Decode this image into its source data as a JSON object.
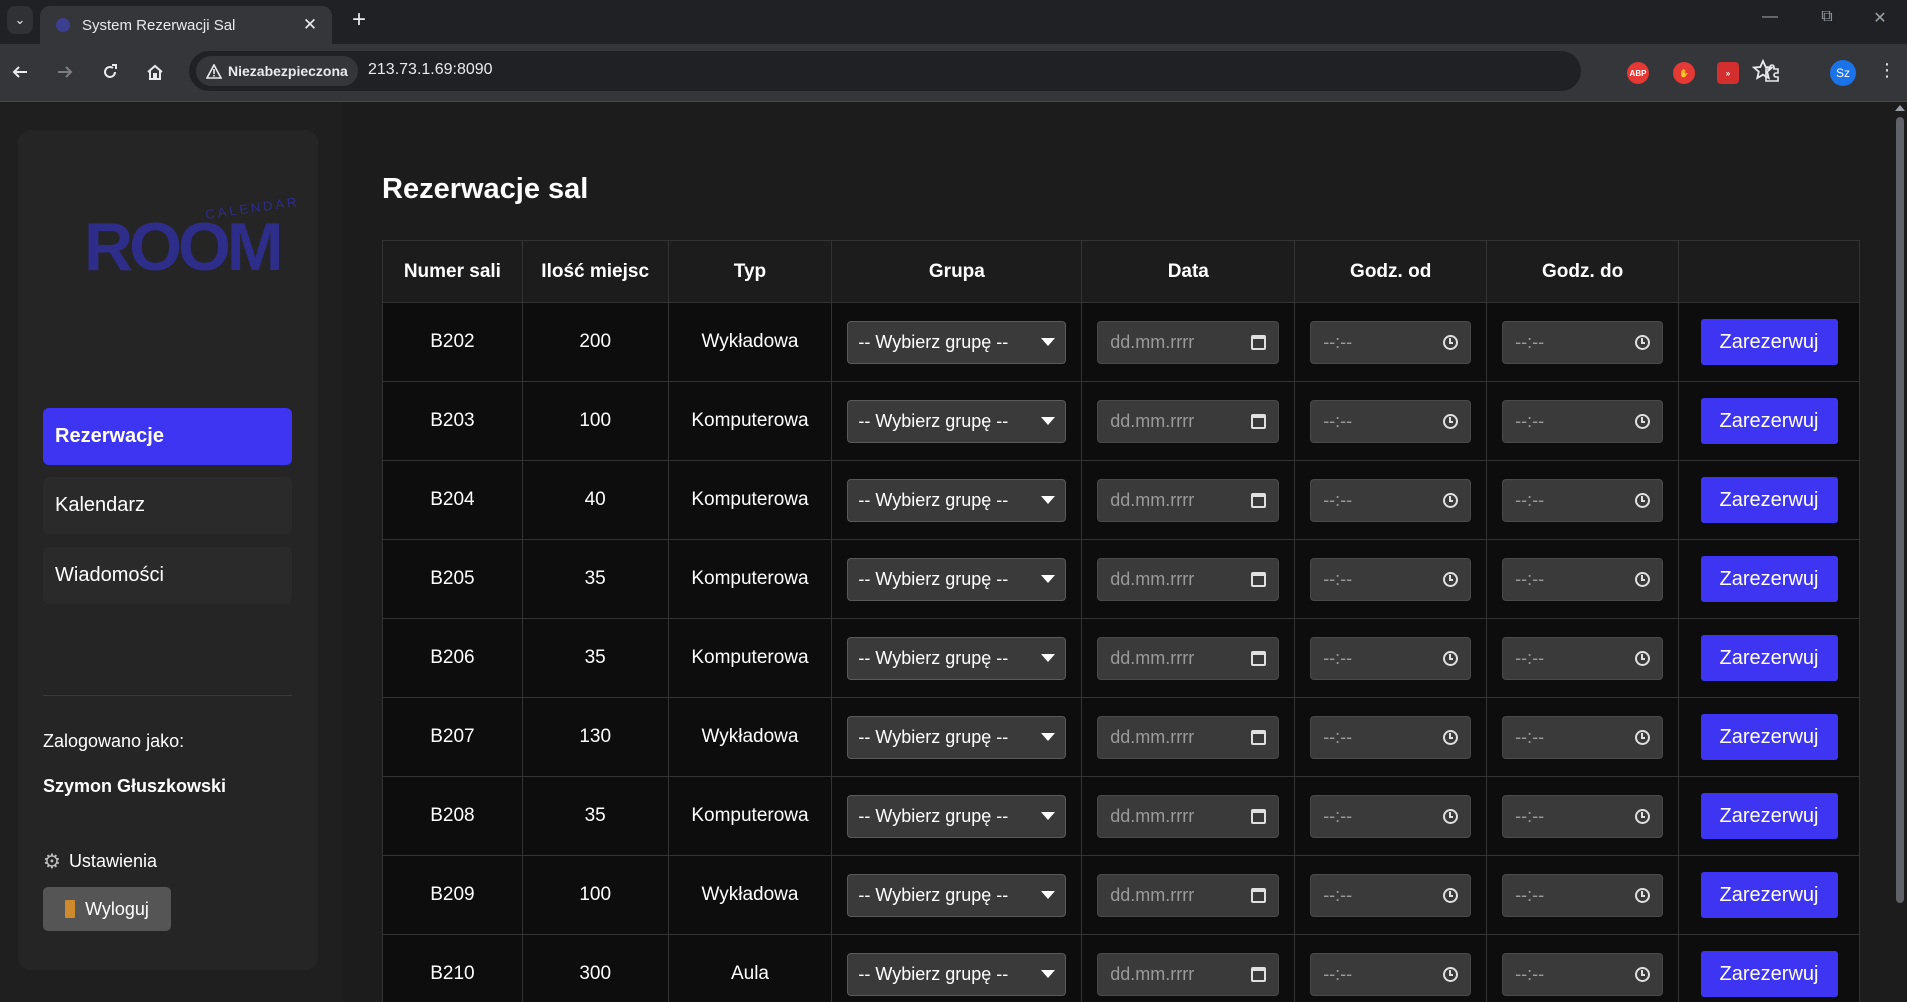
{
  "browser": {
    "tab_title": "System Rezerwacji Sal",
    "security_label": "Niezabezpieczona",
    "url": "213.73.1.69:8090",
    "extensions": [
      {
        "name": "abp-extension-icon",
        "label": "ABP",
        "color": "#e53935"
      },
      {
        "name": "hand-extension-icon",
        "label": "",
        "color": "#e53935"
      },
      {
        "name": "arrows-extension-icon",
        "label": "",
        "color": "#d32f2f"
      }
    ],
    "profile_initials": "Sz"
  },
  "sidebar": {
    "logo_main": "ROOM",
    "logo_sub": "CALENDAR",
    "nav": [
      {
        "label": "Rezerwacje",
        "active": true
      },
      {
        "label": "Kalendarz",
        "active": false
      },
      {
        "label": "Wiadomości",
        "active": false
      }
    ],
    "logged_label": "Zalogowano jako:",
    "user_name": "Szymon Głuszkowski",
    "settings_label": "Ustawienia",
    "logout_label": "Wyloguj"
  },
  "main": {
    "title": "Rezerwacje sal",
    "columns": [
      "Numer sali",
      "Ilość miejsc",
      "Typ",
      "Grupa",
      "Data",
      "Godz. od",
      "Godz. do",
      ""
    ],
    "group_placeholder": "-- Wybierz grupę --",
    "date_placeholder": "dd.mm.rrrr",
    "time_placeholder": "--:--",
    "reserve_label": "Zarezerwuj",
    "rows": [
      {
        "room": "B202",
        "seats": "200",
        "type": "Wykładowa"
      },
      {
        "room": "B203",
        "seats": "100",
        "type": "Komputerowa"
      },
      {
        "room": "B204",
        "seats": "40",
        "type": "Komputerowa"
      },
      {
        "room": "B205",
        "seats": "35",
        "type": "Komputerowa"
      },
      {
        "room": "B206",
        "seats": "35",
        "type": "Komputerowa"
      },
      {
        "room": "B207",
        "seats": "130",
        "type": "Wykładowa"
      },
      {
        "room": "B208",
        "seats": "35",
        "type": "Komputerowa"
      },
      {
        "room": "B209",
        "seats": "100",
        "type": "Wykładowa"
      },
      {
        "room": "B210",
        "seats": "300",
        "type": "Aula"
      }
    ]
  },
  "colors": {
    "accent": "#3d35f2",
    "logo": "#2e2d8a"
  }
}
